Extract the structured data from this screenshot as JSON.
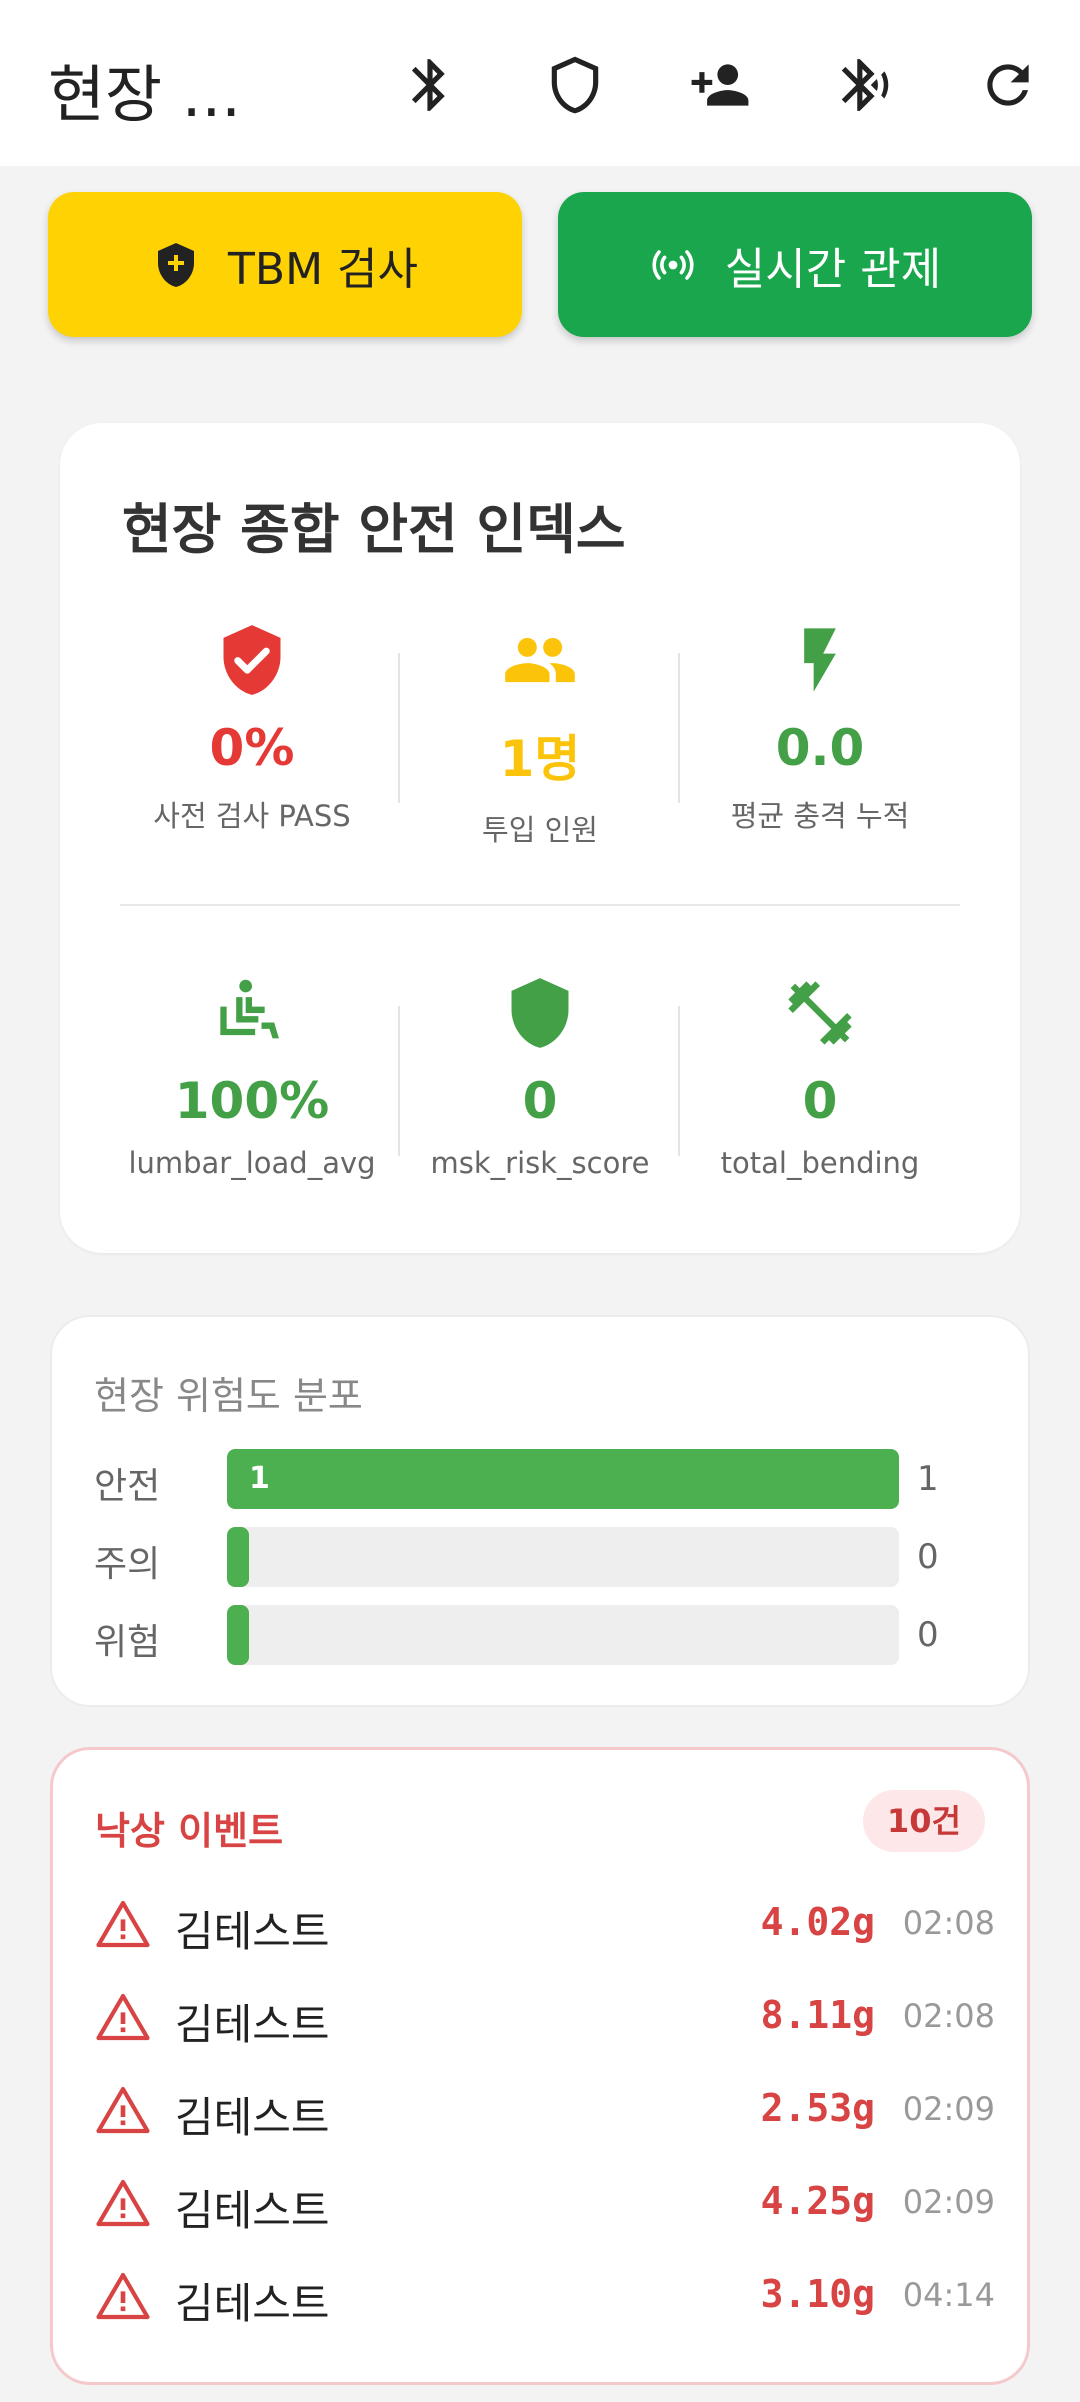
{
  "appbar": {
    "title": "현장 ...",
    "actions": [
      "bluetooth-icon",
      "shield-icon",
      "person-add-icon",
      "bluetooth-searching-icon",
      "refresh-icon"
    ]
  },
  "buttons": {
    "tbm_label": "TBM 검사",
    "live_label": "실시간 관제"
  },
  "safety_index": {
    "title": "현장 종합 안전 인덱스",
    "metrics": [
      {
        "value": "0%",
        "label": "사전 검사 PASS",
        "color": "#e53935",
        "icon": "shield-check-icon"
      },
      {
        "value": "1명",
        "label": "투입 인원",
        "color": "#fbc40b",
        "icon": "people-icon"
      },
      {
        "value": "0.0",
        "label": "평균 충격 누적",
        "color": "#43a047",
        "icon": "bolt-icon"
      },
      {
        "value": "100%",
        "label": "lumbar_load_avg",
        "color": "#43a047",
        "icon": "seated-person-icon"
      },
      {
        "value": "0",
        "label": "msk_risk_score",
        "color": "#43a047",
        "icon": "shield-icon"
      },
      {
        "value": "0",
        "label": "total_bending",
        "color": "#43a047",
        "icon": "dumbbell-icon"
      }
    ]
  },
  "risk_distribution": {
    "title": "현장 위험도 분포",
    "rows": [
      {
        "label": "안전",
        "count": "1",
        "bar_text": "1",
        "fraction": 1.0
      },
      {
        "label": "주의",
        "count": "0",
        "bar_text": "",
        "fraction": 0
      },
      {
        "label": "위험",
        "count": "0",
        "bar_text": "",
        "fraction": 0
      }
    ]
  },
  "fall_events": {
    "title": "낙상 이벤트",
    "badge": "10건",
    "items": [
      {
        "name": "김테스트",
        "g": "4.02g",
        "time": "02:08"
      },
      {
        "name": "김테스트",
        "g": "8.11g",
        "time": "02:08"
      },
      {
        "name": "김테스트",
        "g": "2.53g",
        "time": "02:09"
      },
      {
        "name": "김테스트",
        "g": "4.25g",
        "time": "02:09"
      },
      {
        "name": "김테스트",
        "g": "3.10g",
        "time": "04:14"
      }
    ]
  }
}
